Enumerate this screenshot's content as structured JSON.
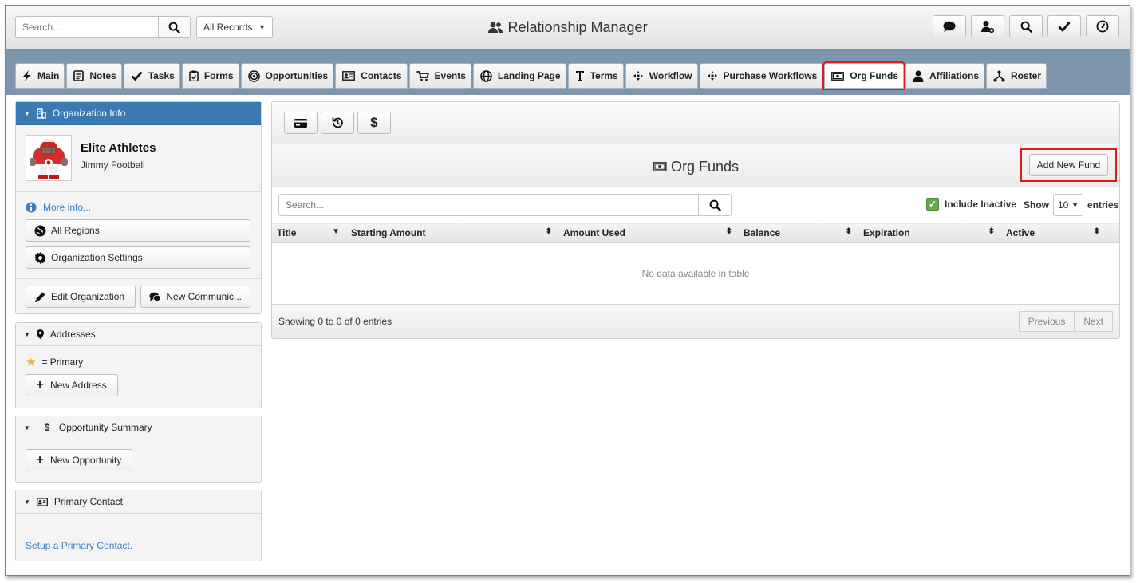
{
  "header": {
    "search_placeholder": "Search...",
    "records_select": "All Records",
    "app_title": "Relationship Manager",
    "icon_buttons": [
      "chat-icon",
      "user-settings-icon",
      "search-icon",
      "check-icon",
      "dashboard-icon"
    ]
  },
  "tabs": [
    {
      "label": "Main",
      "icon": "bolt-icon"
    },
    {
      "label": "Notes",
      "icon": "notes-icon"
    },
    {
      "label": "Tasks",
      "icon": "check-icon"
    },
    {
      "label": "Forms",
      "icon": "clipboard-icon"
    },
    {
      "label": "Opportunities",
      "icon": "target-icon"
    },
    {
      "label": "Contacts",
      "icon": "contact-card-icon"
    },
    {
      "label": "Events",
      "icon": "cart-icon"
    },
    {
      "label": "Landing Page",
      "icon": "globe-icon"
    },
    {
      "label": "Terms",
      "icon": "text-icon"
    },
    {
      "label": "Workflow",
      "icon": "workflow-icon"
    },
    {
      "label": "Purchase Workflows",
      "icon": "workflow-icon"
    },
    {
      "label": "Org Funds",
      "icon": "money-icon",
      "active": true
    },
    {
      "label": "Affiliations",
      "icon": "person-icon"
    },
    {
      "label": "Roster",
      "icon": "roster-icon"
    }
  ],
  "org_info": {
    "header": "Organization Info",
    "name": "Elite Athletes",
    "contact": "Jimmy Football",
    "more_info": "More info...",
    "all_regions": "All Regions",
    "org_settings": "Organization Settings",
    "edit_org": "Edit Organization",
    "new_comm": "New Communic..."
  },
  "addresses": {
    "header": "Addresses",
    "primary_legend": "= Primary",
    "new_address": "New Address"
  },
  "opportunity_summary": {
    "header": "Opportunity Summary",
    "new_opportunity": "New Opportunity"
  },
  "primary_contact": {
    "header": "Primary Contact",
    "setup_link": "Setup a Primary Contact."
  },
  "funds": {
    "title": "Org Funds",
    "add_button": "Add New Fund",
    "search_placeholder": "Search...",
    "include_inactive": "Include Inactive",
    "show_label": "Show",
    "page_size": "10",
    "entries_label": "entries",
    "columns": [
      "Title",
      "Starting Amount",
      "Amount Used",
      "Balance",
      "Expiration",
      "Active"
    ],
    "empty_message": "No data available in table",
    "showing": "Showing 0 to 0 of 0 entries",
    "prev": "Previous",
    "next": "Next"
  }
}
